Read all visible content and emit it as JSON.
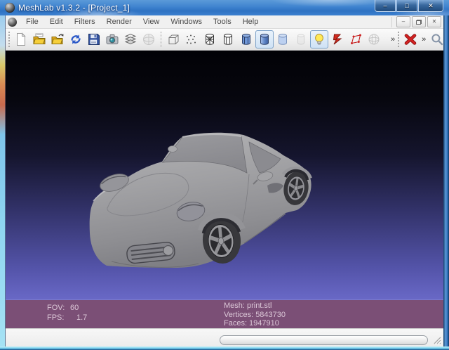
{
  "window": {
    "title": "MeshLab v1.3.2 - [Project_1]"
  },
  "window_controls": {
    "minimize": "–",
    "maximize": "□",
    "close": "✕"
  },
  "mdi_controls": {
    "minimize": "–",
    "close": "✕"
  },
  "menubar": {
    "items": [
      {
        "label": "File"
      },
      {
        "label": "Edit"
      },
      {
        "label": "Filters"
      },
      {
        "label": "Render"
      },
      {
        "label": "View"
      },
      {
        "label": "Windows"
      },
      {
        "label": "Tools"
      },
      {
        "label": "Help"
      }
    ]
  },
  "toolbar": {
    "overflow_glyph": "»",
    "icon_names": [
      "new-project",
      "open-project",
      "import-mesh",
      "reload",
      "save",
      "snapshot",
      "layer-dialog",
      "raster-mode",
      "render-bbox",
      "render-points",
      "render-wireframe",
      "render-hidden-lines",
      "render-flat-lines",
      "render-smooth",
      "render-flat",
      "render-texture",
      "light-toggle",
      "backface-culling",
      "selection-decorator",
      "trackball",
      "delete-current-mesh",
      "search"
    ],
    "pressed": [
      "render-smooth",
      "light-toggle"
    ],
    "disabled": [
      "raster-mode",
      "render-texture",
      "trackball"
    ]
  },
  "viewport": {
    "hud": {
      "fov_label": "FOV:",
      "fov_value": "60",
      "fps_label": "FPS:",
      "fps_value": "1.7",
      "mesh_label": "Mesh:",
      "mesh_value": "print.stl",
      "vertices_label": "Vertices:",
      "vertices_value": "5843730",
      "faces_label": "Faces:",
      "faces_value": "1947910"
    },
    "background_top": "#020206",
    "background_bottom": "#7a79da",
    "hud_bar_color": "#7b4f76"
  },
  "statusbar": {
    "progress_percent": 0
  }
}
